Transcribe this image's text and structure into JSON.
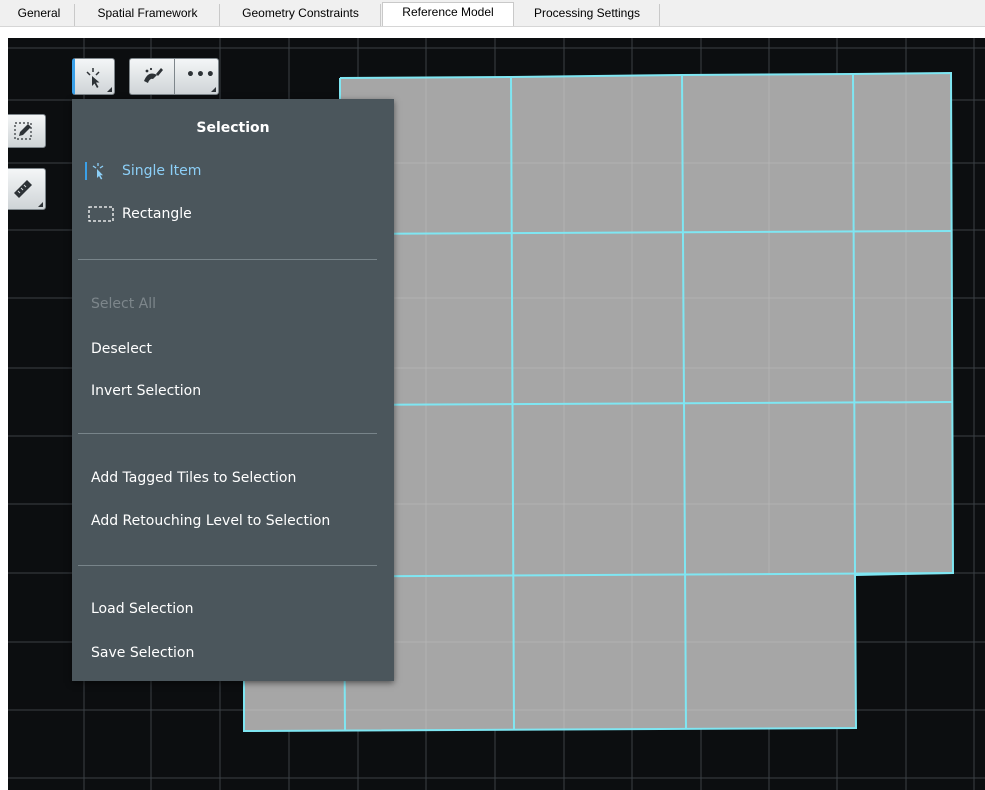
{
  "tabs": [
    {
      "label": "General",
      "active": false
    },
    {
      "label": "Spatial Framework",
      "active": false
    },
    {
      "label": "Geometry Constraints",
      "active": false
    },
    {
      "label": "Reference Model",
      "active": true
    },
    {
      "label": "Processing Settings",
      "active": false
    }
  ],
  "toolbar": {
    "select_icon": "selection-cursor-icon",
    "brush_icon": "brush-icon",
    "more_icon": "more-dots-icon",
    "more_label": "•••"
  },
  "side_tools": {
    "edit_icon": "pencil-edit-icon",
    "measure_icon": "ruler-measure-icon"
  },
  "selection_menu": {
    "title": "Selection",
    "modes": [
      {
        "label": "Single Item",
        "icon": "cursor-icon",
        "selected": true
      },
      {
        "label": "Rectangle",
        "icon": "dashed-rectangle-icon",
        "selected": false
      }
    ],
    "actions": [
      {
        "label": "Select All",
        "enabled": false
      },
      {
        "label": "Deselect",
        "enabled": true
      },
      {
        "label": "Invert Selection",
        "enabled": true
      }
    ],
    "add_actions": [
      {
        "label": "Add Tagged Tiles to Selection"
      },
      {
        "label": "Add Retouching Level to Selection"
      }
    ],
    "file_actions": [
      {
        "label": "Load Selection"
      },
      {
        "label": "Save Selection"
      }
    ]
  },
  "colors": {
    "viewport_bg": "#0c0e10",
    "tile_fill": "#a6a6a6",
    "tile_outline": "#7fe6f2",
    "menu_bg": "#4b565c",
    "selected_text": "#8ccff7",
    "accent": "#3aa0e8"
  }
}
